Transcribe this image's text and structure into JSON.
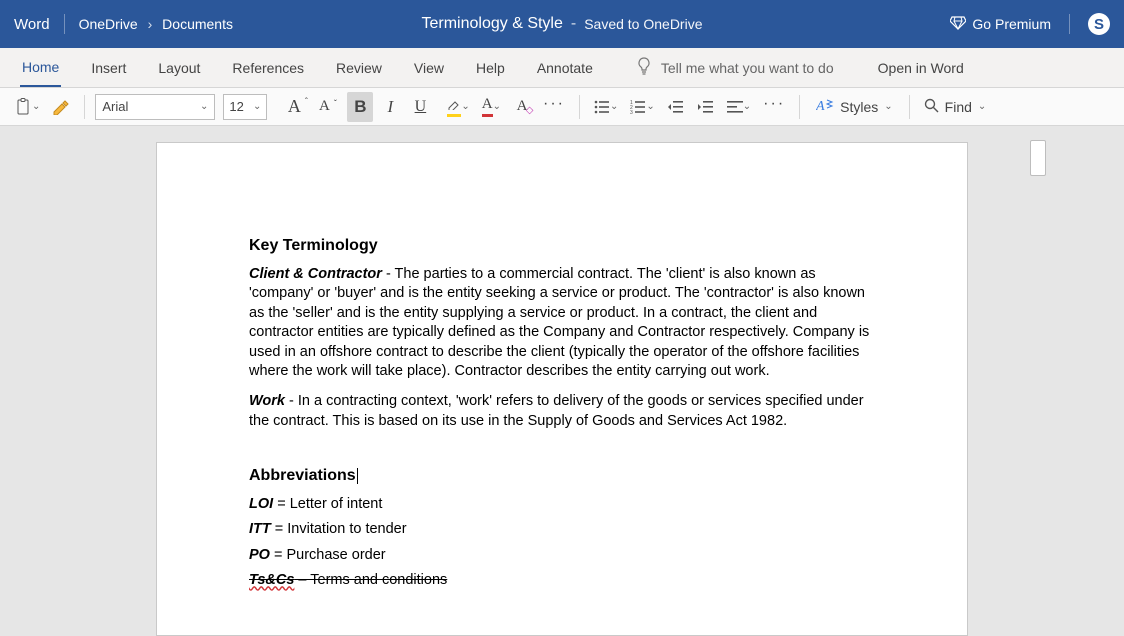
{
  "titlebar": {
    "app_name": "Word",
    "breadcrumb": [
      "OneDrive",
      "Documents"
    ],
    "doc_title": "Terminology & Style",
    "save_status": "Saved to OneDrive",
    "go_premium": "Go Premium"
  },
  "tabs": {
    "items": [
      "Home",
      "Insert",
      "Layout",
      "References",
      "Review",
      "View",
      "Help",
      "Annotate"
    ],
    "active_index": 0,
    "tell_me_placeholder": "Tell me what you want to do",
    "open_in_word": "Open in Word"
  },
  "toolbar": {
    "font_name": "Arial",
    "font_size": "12",
    "styles_label": "Styles",
    "find_label": "Find"
  },
  "document": {
    "heading1": "Key Terminology",
    "para1_term": "Client & Contractor",
    "para1_text": " - The parties to a commercial contract. The 'client' is also known as 'company' or 'buyer' and is the entity seeking a service or product. The 'contractor' is also known as the 'seller' and is the entity supplying a service or product. In a contract, the client and contractor entities are typically defined as the Company and Contractor respectively. Company is used in an offshore contract to describe the client (typically the operator of the offshore facilities where the work will take place). Contractor describes the entity carrying out work.",
    "para2_term": "Work",
    "para2_text": " - In a contracting context, 'work' refers to delivery of the goods or services specified under the contract. This is based on its use in the Supply of Goods and Services Act 1982.",
    "heading2": "Abbreviations",
    "abbr": [
      {
        "term": "LOI",
        "def": " = Letter of intent"
      },
      {
        "term": "ITT",
        "def": " = Invitation to tender"
      },
      {
        "term": "PO",
        "def": " = Purchase order"
      }
    ],
    "struck_term": "Ts&Cs",
    "struck_def": " – Terms and conditions"
  }
}
